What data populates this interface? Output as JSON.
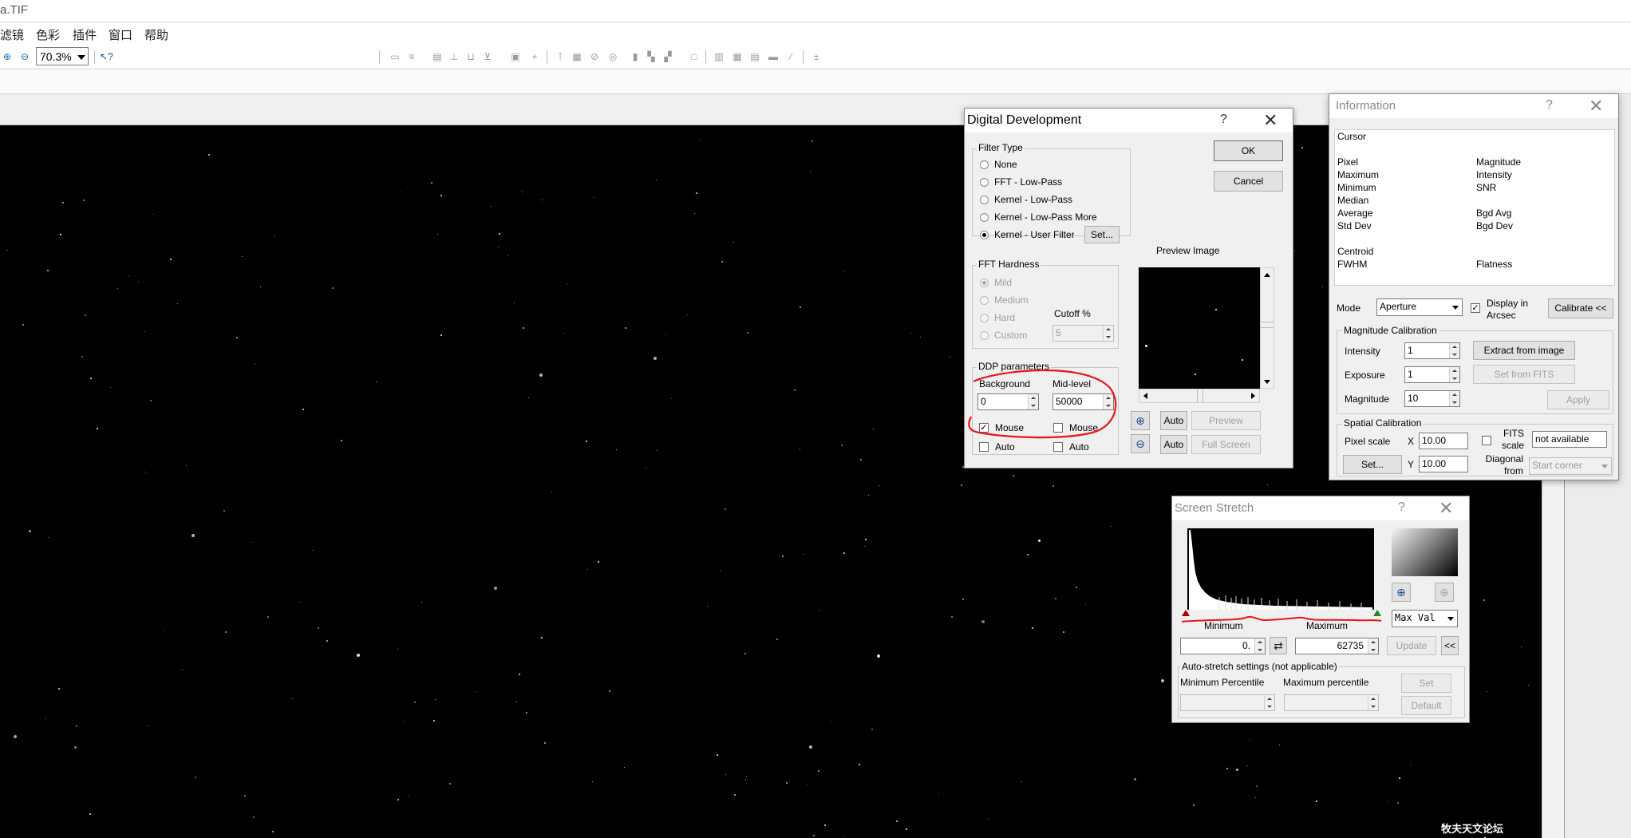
{
  "window": {
    "title": "a.TIF"
  },
  "menu": [
    "滤镜",
    "色彩",
    "插件",
    "窗口",
    "帮助"
  ],
  "toolbar": {
    "zoom_value": "70.3%"
  },
  "digital_development": {
    "title": "Digital Development",
    "help": "?",
    "close": "✕",
    "ok": "OK",
    "cancel": "Cancel",
    "filter_type_label": "Filter Type",
    "filters": [
      "None",
      "FFT - Low-Pass",
      "Kernel - Low-Pass",
      "Kernel - Low-Pass More",
      "Kernel - User Filter"
    ],
    "selected_filter": "Kernel - User Filter",
    "set_button": "Set...",
    "fft_hardness_label": "FFT Hardness",
    "hardness": [
      "Mild",
      "Medium",
      "Hard",
      "Custom"
    ],
    "cutoff_label": "Cutoff %",
    "cutoff_value": "5",
    "ddp_label": "DDP parameters",
    "background_label": "Background",
    "background_value": "0",
    "midlevel_label": "Mid-level",
    "midlevel_value": "50000",
    "mouse1": "Mouse",
    "mouse2": "Mouse",
    "auto1": "Auto",
    "auto2": "Auto",
    "mouse1_checked": true,
    "preview_label": "Preview Image",
    "auto_a": "Auto",
    "auto_b": "Auto",
    "preview_button": "Preview",
    "fullscreen_button": "Full Screen"
  },
  "information": {
    "title": "Information",
    "help": "?",
    "close": "✕",
    "cursor_label": "Cursor",
    "left_fields": [
      "Pixel",
      "Maximum",
      "Minimum",
      "Median",
      "Average",
      "Std Dev"
    ],
    "right_fields": [
      "Magnitude",
      "Intensity",
      "SNR",
      "Bgd Avg",
      "Bgd Dev"
    ],
    "centroid_label": "Centroid",
    "fwhm_label": "FWHM",
    "flatness_label": "Flatness",
    "mode_label": "Mode",
    "mode_value": "Aperture",
    "display_arcsec_label": "Display in Arcsec",
    "display_arcsec_checked": true,
    "calibrate_button": "Calibrate <<",
    "mag_cal_label": "Magnitude Calibration",
    "intensity_label": "Intensity",
    "intensity_value": "1",
    "exposure_label": "Exposure",
    "exposure_value": "1",
    "magnitude_label": "Magnitude",
    "magnitude_value": "10",
    "extract_button": "Extract from image",
    "set_from_fits_button": "Set from FITS",
    "apply_button": "Apply",
    "spatial_label": "Spatial Calibration",
    "pixel_scale_label": "Pixel scale",
    "x_label": "X",
    "x_value": "10.00",
    "y_label": "Y",
    "y_value": "10.00",
    "fits_scale_label": "FITS scale",
    "not_available": "not available",
    "set_button": "Set...",
    "diagonal_label": "Diagonal from",
    "start_corner": "Start corner"
  },
  "screen_stretch": {
    "title": "Screen Stretch",
    "help": "?",
    "close": "✕",
    "minimum_label": "Minimum",
    "maximum_label": "Maximum",
    "min_value": "0.",
    "max_value": "62735",
    "mode_value": "Max Val",
    "update_button": "Update",
    "collapse_button": "<<",
    "auto_label": "Auto-stretch settings (not applicable)",
    "min_pct_label": "Minimum Percentile",
    "max_pct_label": "Maximum percentile",
    "set_button": "Set",
    "default_button": "Default"
  },
  "watermark": "牧夫天文论坛 www.astronomy.com.cn",
  "colors": {
    "annotation": "#e8141e",
    "histogram_bg": "#000000",
    "image_bg": "#000000"
  }
}
